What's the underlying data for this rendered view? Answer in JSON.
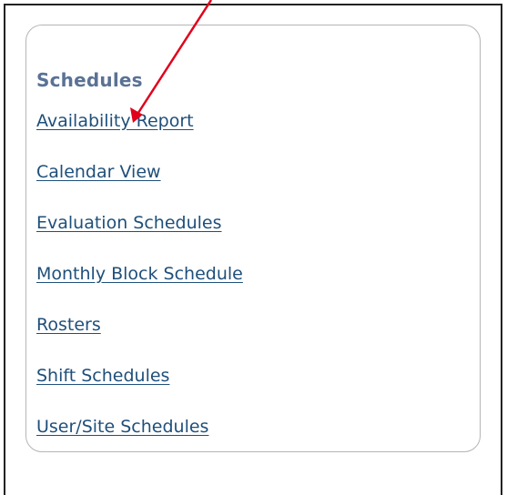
{
  "panel": {
    "title": "Schedules",
    "links": [
      {
        "label": "Availability Report"
      },
      {
        "label": "Calendar View"
      },
      {
        "label": "Evaluation Schedules"
      },
      {
        "label": "Monthly Block Schedule"
      },
      {
        "label": "Rosters"
      },
      {
        "label": "Shift Schedules"
      },
      {
        "label": "User/Site Schedules"
      }
    ]
  },
  "colors": {
    "title": "#5a7295",
    "link": "#1f4f7a",
    "annotation_arrow": "#e0001b",
    "panel_border": "#b5b5b5"
  },
  "annotation": {
    "icon": "red-arrow-icon"
  }
}
